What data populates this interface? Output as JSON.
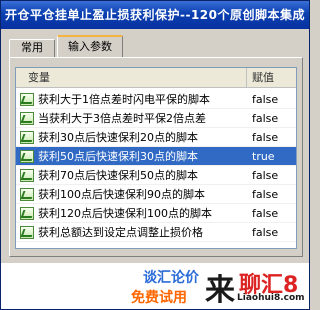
{
  "window": {
    "title": "开仓平仓挂单止盈止损获利保护--120个原创脚本集成"
  },
  "tabs": [
    {
      "label": "常用",
      "active": false
    },
    {
      "label": "输入参数",
      "active": true
    }
  ],
  "table": {
    "headers": {
      "name": "变量",
      "value": "赋值"
    },
    "rows": [
      {
        "name": "获利大于1倍点差时闪电平保的脚本",
        "value": "false",
        "selected": false
      },
      {
        "name": "当获利大于3倍点差时平保2倍点差",
        "value": "false",
        "selected": false
      },
      {
        "name": "获利30点后快速保利20点的脚本",
        "value": "false",
        "selected": false
      },
      {
        "name": "获利50点后快速保利30点的脚本",
        "value": "true",
        "selected": true
      },
      {
        "name": "获利70点后快速保利50点的脚本",
        "value": "false",
        "selected": false
      },
      {
        "name": "获利100点后快速保利90点的脚本",
        "value": "false",
        "selected": false
      },
      {
        "name": "获利120点后快速保利100点的脚本",
        "value": "false",
        "selected": false
      },
      {
        "name": "获利总额达到设定点调整止损价格",
        "value": "false",
        "selected": false
      }
    ]
  },
  "footer": {
    "ad_line1": "谈汇论价",
    "ad_line2": "免费试用",
    "logo_char": "来",
    "logo_big": "聊汇8",
    "logo_url": "Liaohui8.com"
  },
  "colors": {
    "selection": "#316ac5",
    "title_bar": "#0a3fb0"
  }
}
